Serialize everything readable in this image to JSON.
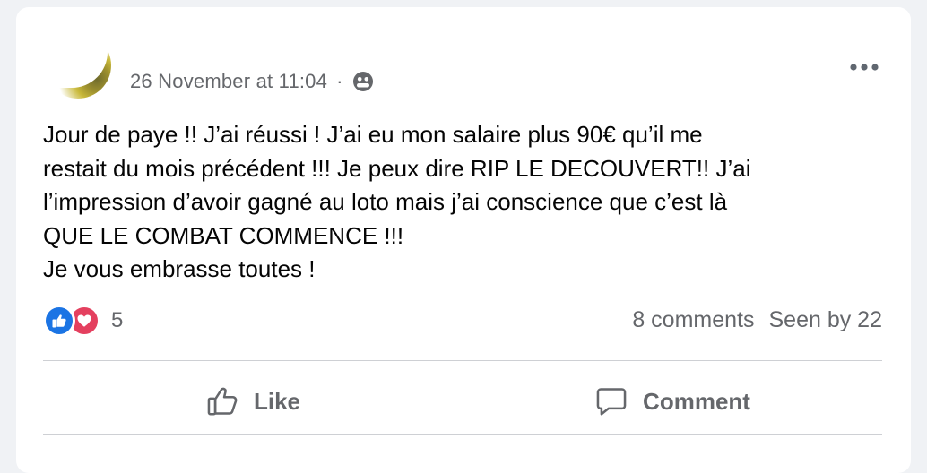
{
  "post": {
    "timestamp": "26 November at 11:04",
    "separator": "·",
    "audience_icon": "friends-icon",
    "more_icon": "more-options-icon",
    "text": "Jour de paye !! J’ai réussi ! J’ai eu mon salaire plus 90€ qu’il me\nrestait du mois précédent !!! Je peux dire RIP LE DECOUVERT!! J’ai\nl’impression d’avoir gagné au loto mais j’ai conscience que c’est là\nQUE LE COMBAT COMMENCE !!!\nJe vous embrasse toutes !"
  },
  "stats": {
    "reaction_icons": [
      "like-reaction-icon",
      "love-reaction-icon"
    ],
    "reaction_count": "5",
    "comments": "8 comments",
    "seen_by": "Seen by 22"
  },
  "actions": {
    "like_label": "Like",
    "comment_label": "Comment"
  },
  "colors": {
    "like_blue": "#1b74e4",
    "love_red": "#e4405f",
    "secondary_text": "#65676b"
  }
}
